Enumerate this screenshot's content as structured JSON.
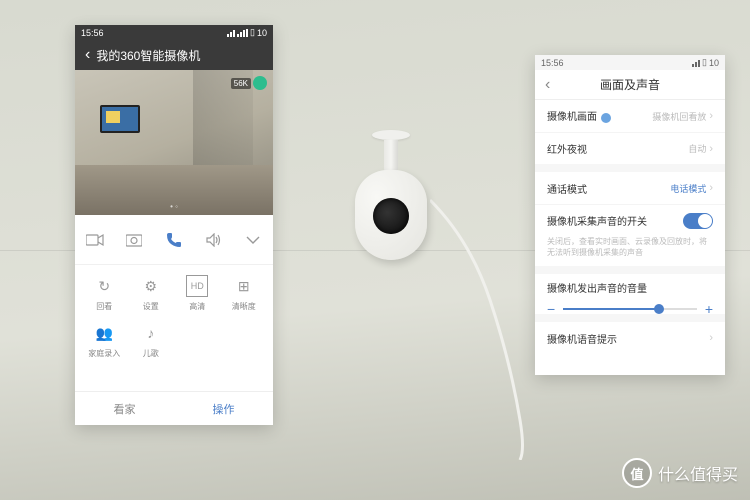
{
  "left": {
    "status": {
      "time": "15:56",
      "battery": "10"
    },
    "nav": {
      "title": "我的360智能摄像机"
    },
    "video": {
      "badge": "56K"
    },
    "actions": [
      "record",
      "snapshot",
      "call",
      "speaker",
      "more"
    ],
    "grid": [
      {
        "icon": "↻",
        "label": "回看"
      },
      {
        "icon": "⚙",
        "label": "设置"
      },
      {
        "icon": "HD",
        "label": "高清"
      },
      {
        "icon": "⊞",
        "label": "清晰度"
      },
      {
        "icon": "👥",
        "label": "家庭录入"
      },
      {
        "icon": "♪",
        "label": "儿歌"
      }
    ],
    "tabs": [
      {
        "label": "看家",
        "active": false
      },
      {
        "label": "操作",
        "active": true
      }
    ]
  },
  "right": {
    "status": {
      "time": "15:56",
      "battery": "10"
    },
    "nav": {
      "title": "画面及声音"
    },
    "rows": {
      "r1": {
        "label": "摄像机画面",
        "value": "摄像机回看放"
      },
      "r2": {
        "label": "红外夜视",
        "value": "自动"
      },
      "r3": {
        "label": "通话模式",
        "value": "电话模式"
      },
      "r4": {
        "label": "摄像机采集声音的开关"
      },
      "r4sub": "关闭后，查看实时画面、云录像及回放时，将无法听到摄像机采集的声音",
      "r5": {
        "label": "摄像机发出声音的音量"
      },
      "r6": {
        "label": "摄像机语音提示"
      }
    }
  },
  "watermark": "什么值得买"
}
